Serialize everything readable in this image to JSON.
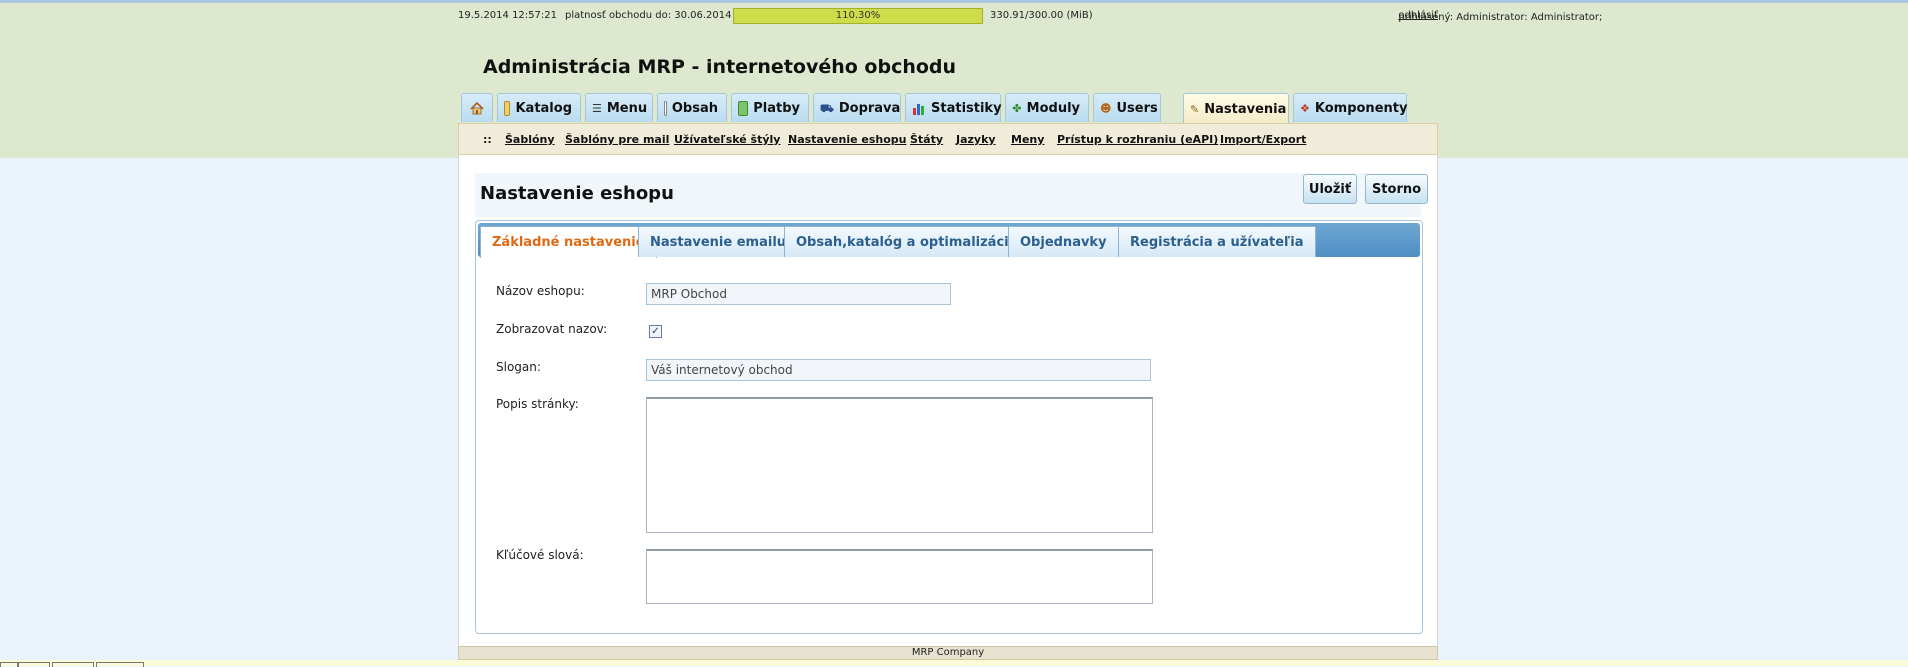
{
  "status": {
    "datetime": "19.5.2014 12:57:21",
    "validity": "platnosť obchodu do: 30.06.2014",
    "quota_percent": "110.30%",
    "quota_value": 1.103,
    "storage": "330.91/300.00 (MiB)",
    "user_prefix": "prihlásený: Administrator: Administrator;",
    "logout": "odhlásiť",
    "bar_color": "#cfdc4a"
  },
  "app_title": "Administrácia MRP - internetového obchodu",
  "main_nav": [
    {
      "label": "",
      "icon": "home-icon"
    },
    {
      "label": "Katalog",
      "icon": "folder-icon"
    },
    {
      "label": "Menu",
      "icon": "list-icon"
    },
    {
      "label": "Obsah",
      "icon": "document-icon"
    },
    {
      "label": "Platby",
      "icon": "money-icon"
    },
    {
      "label": "Doprava",
      "icon": "truck-icon"
    },
    {
      "label": "Statistiky",
      "icon": "bar-chart-icon"
    },
    {
      "label": "Moduly",
      "icon": "puzzle-icon"
    },
    {
      "label": "Users",
      "icon": "users-icon"
    },
    {
      "label": "Nastavenia",
      "icon": "settings-edit-icon"
    },
    {
      "label": "Komponenty",
      "icon": "components-icon"
    }
  ],
  "subnav": {
    "bullet": "::",
    "items": [
      "Šablóny",
      "Šablóny pre mail",
      "Užívateľské štýly",
      "Nastavenie eshopu",
      "Štáty",
      "Jazyky",
      "Meny",
      "Prístup k rozhraniu (eAPI)",
      "Import/Export"
    ]
  },
  "page": {
    "title": "Nastavenie eshopu",
    "save_label": "Uložiť",
    "cancel_label": "Storno"
  },
  "form_tabs": [
    "Základné nastavenie",
    "Nastavenie emailu",
    "Obsah,katalóg a optimalizácia",
    "Objednavky",
    "Registrácia a užívateľia"
  ],
  "form": {
    "shop_name_label": "Názov eshopu:",
    "shop_name_value": "MRP Obchod",
    "show_name_label": "Zobrazovat nazov:",
    "show_name_checked": true,
    "slogan_label": "Slogan:",
    "slogan_value": "Váš internetový obchod",
    "description_label": "Popis stránky:",
    "description_value": "",
    "keywords_label": "Kľúčové slová:",
    "keywords_value": ""
  },
  "footer": "MRP Company"
}
